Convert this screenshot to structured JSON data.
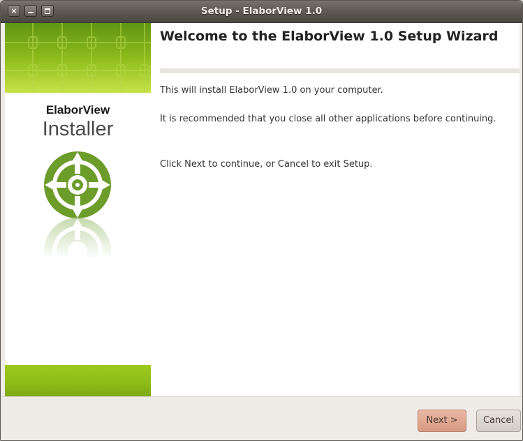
{
  "window": {
    "title": "Setup - ElaborView 1.0",
    "controls": {
      "close": "×"
    }
  },
  "sidebar": {
    "brand": "ElaborView",
    "product": "Installer",
    "accent_color": "#8dbb16",
    "logo_icon": "elaborview-target-logo"
  },
  "main": {
    "heading": "Welcome to the ElaborView 1.0 Setup Wizard",
    "paragraphs": [
      "This will install ElaborView 1.0 on your computer.",
      "It is recommended that you close all other applications before continuing.",
      "Click Next to continue, or Cancel to exit Setup."
    ]
  },
  "buttons": {
    "next": "Next >",
    "cancel": "Cancel"
  }
}
